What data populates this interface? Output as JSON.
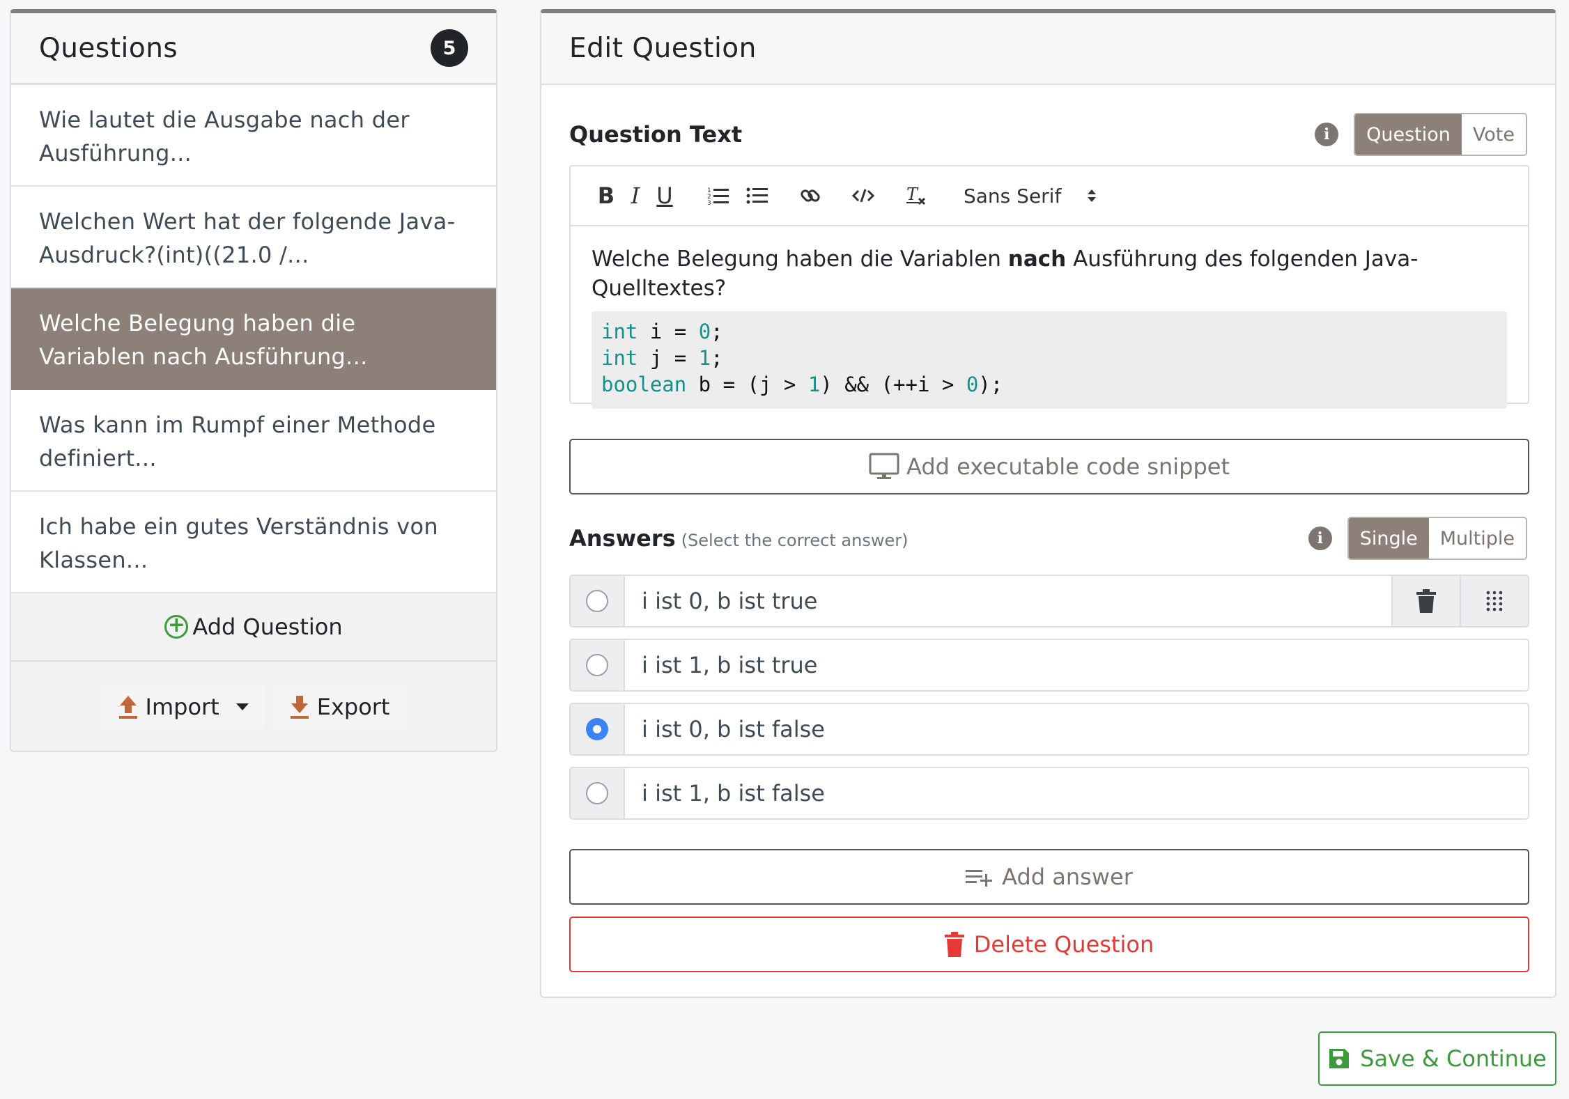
{
  "sidebar": {
    "title": "Questions",
    "count": "5",
    "items": [
      {
        "label": "Wie lautet die Ausgabe nach der Ausführung..."
      },
      {
        "label": "Welchen Wert hat der folgende Java-Ausdruck?(int)((21.0 /..."
      },
      {
        "label": "Welche Belegung haben die Variablen nach Ausführung..."
      },
      {
        "label": "Was kann im Rumpf einer Methode definiert..."
      },
      {
        "label": "Ich habe ein gutes Verständnis von Klassen..."
      }
    ],
    "add_label": "Add Question",
    "import_label": "Import",
    "export_label": "Export"
  },
  "editor": {
    "title": "Edit Question",
    "question_text_label": "Question Text",
    "mode_toggle": [
      "Question",
      "Vote"
    ],
    "font_select": "Sans Serif",
    "question_pre": "Welche Belegung haben die Variablen ",
    "question_bold": "nach",
    "question_post": " Ausführung des folgenden Java-Quelltextes?",
    "code_lines": [
      {
        "kw": "int",
        "rest": " i = ",
        "num": "0",
        "end": ";"
      },
      {
        "kw": "int",
        "rest": " j = ",
        "num": "1",
        "end": ";"
      },
      {
        "kw": "boolean",
        "rest": " b = (j > ",
        "num": "1",
        "end": ") && (++i > ",
        "num2": "0",
        "end2": ");"
      }
    ],
    "add_snippet_label": "Add executable code snippet",
    "answers_label": "Answers",
    "answers_hint": "(Select the correct answer)",
    "answer_mode_toggle": [
      "Single",
      "Multiple"
    ],
    "answers": [
      {
        "text": "i ist 0, b ist true",
        "checked": false
      },
      {
        "text": "i ist 1, b ist true",
        "checked": false
      },
      {
        "text": "i ist 0, b ist false",
        "checked": true
      },
      {
        "text": "i ist 1, b ist false",
        "checked": false
      }
    ],
    "add_answer_label": "Add answer",
    "delete_label": "Delete Question"
  },
  "footer": {
    "save_label": "Save & Continue"
  },
  "colors": {
    "active_item": "#8c8079",
    "accent_green": "#3c9a3c",
    "danger_red": "#e53935",
    "radio_checked": "#3b82f6",
    "code_keyword": "#13918b",
    "io_arrow": "#c0673a"
  }
}
